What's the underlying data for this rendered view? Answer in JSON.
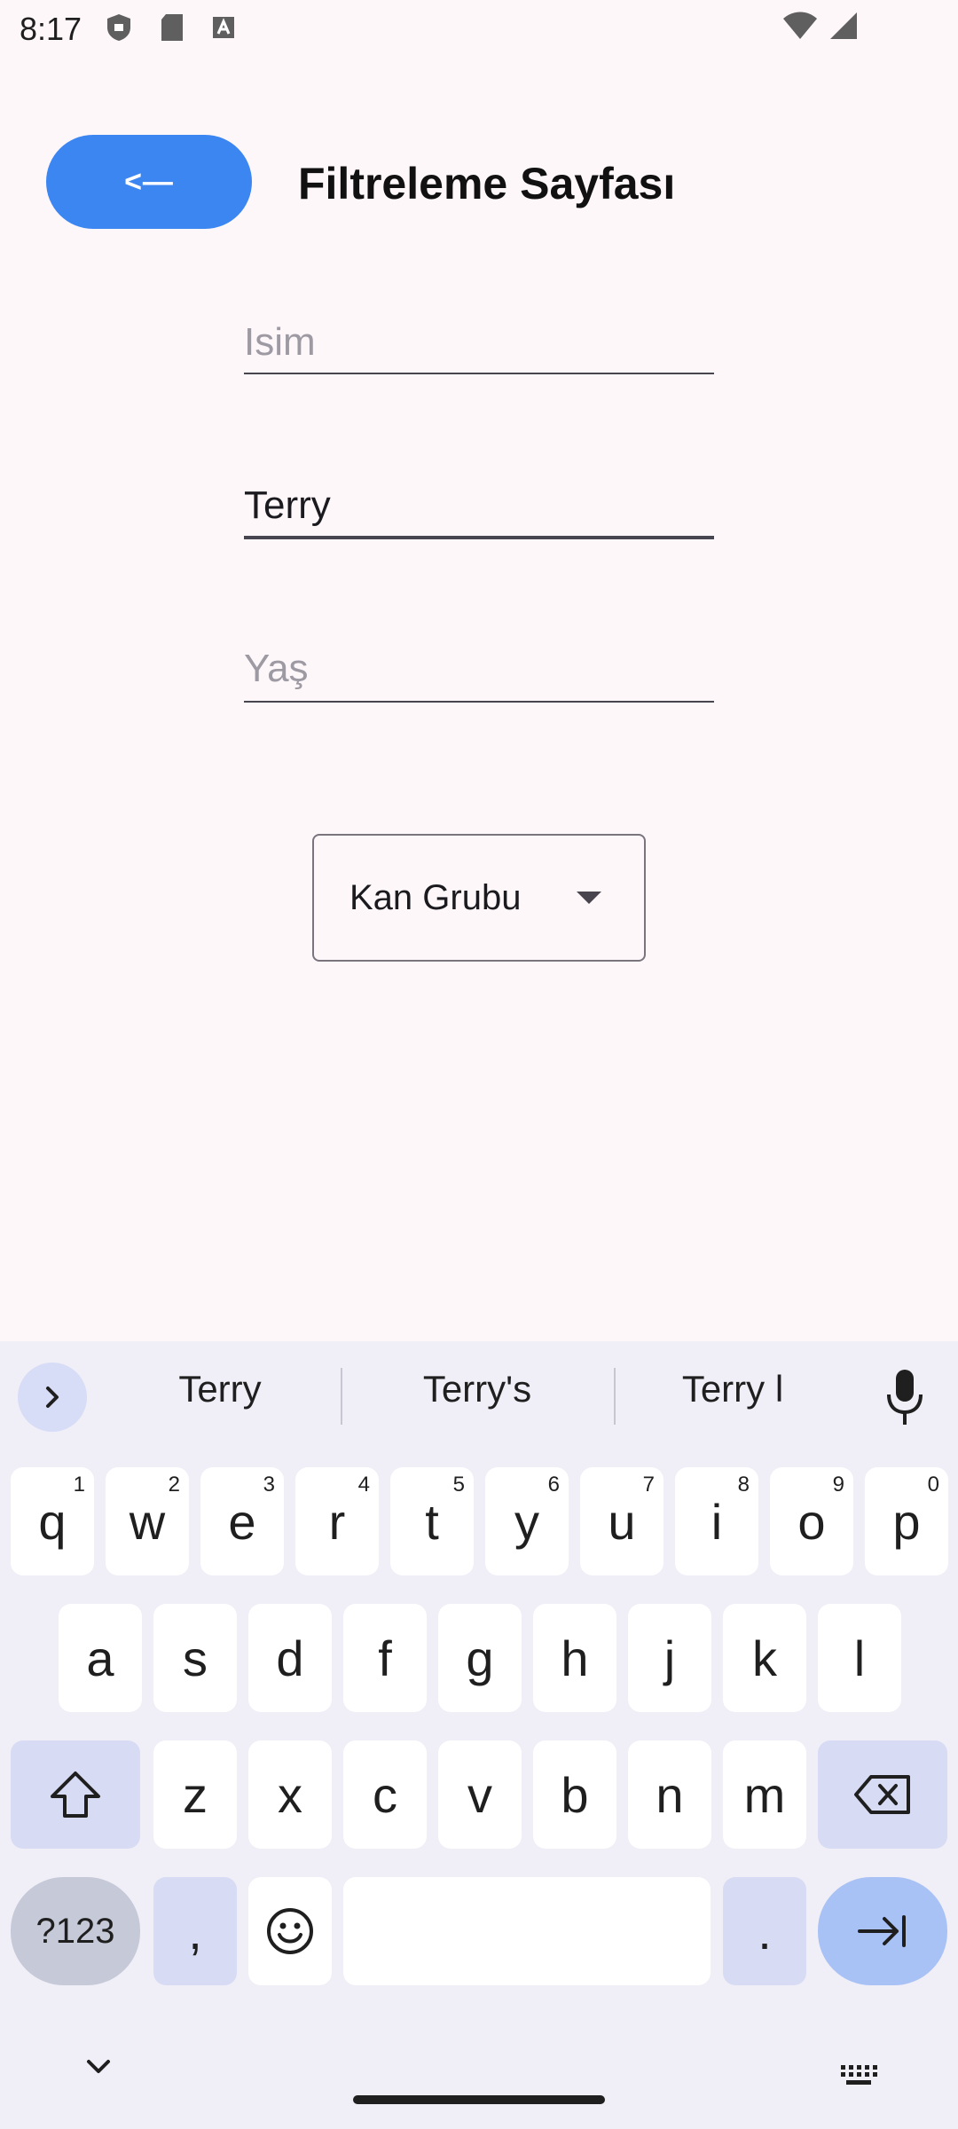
{
  "status_bar": {
    "time": "8:17"
  },
  "header": {
    "back_label": "<—",
    "title": "Filtreleme Sayfası"
  },
  "form": {
    "name_field": {
      "placeholder": "Isim",
      "value": ""
    },
    "surname_field": {
      "placeholder": "",
      "value": "Terry"
    },
    "age_field": {
      "placeholder": "Yaş",
      "value": ""
    },
    "blood_group": {
      "label": "Kan Grubu"
    }
  },
  "keyboard": {
    "suggestions": [
      "Terry",
      "Terry's",
      "Terry l"
    ],
    "row1": [
      {
        "k": "q",
        "h": "1"
      },
      {
        "k": "w",
        "h": "2"
      },
      {
        "k": "e",
        "h": "3"
      },
      {
        "k": "r",
        "h": "4"
      },
      {
        "k": "t",
        "h": "5"
      },
      {
        "k": "y",
        "h": "6"
      },
      {
        "k": "u",
        "h": "7"
      },
      {
        "k": "i",
        "h": "8"
      },
      {
        "k": "o",
        "h": "9"
      },
      {
        "k": "p",
        "h": "0"
      }
    ],
    "row2": [
      "a",
      "s",
      "d",
      "f",
      "g",
      "h",
      "j",
      "k",
      "l"
    ],
    "row3": [
      "z",
      "x",
      "c",
      "v",
      "b",
      "n",
      "m"
    ],
    "symbols_label": "?123",
    "comma": ",",
    "period": "."
  },
  "colors": {
    "accent": "#3c86f2",
    "background": "#fef7fa",
    "keyboard_bg": "#f0eef6"
  }
}
